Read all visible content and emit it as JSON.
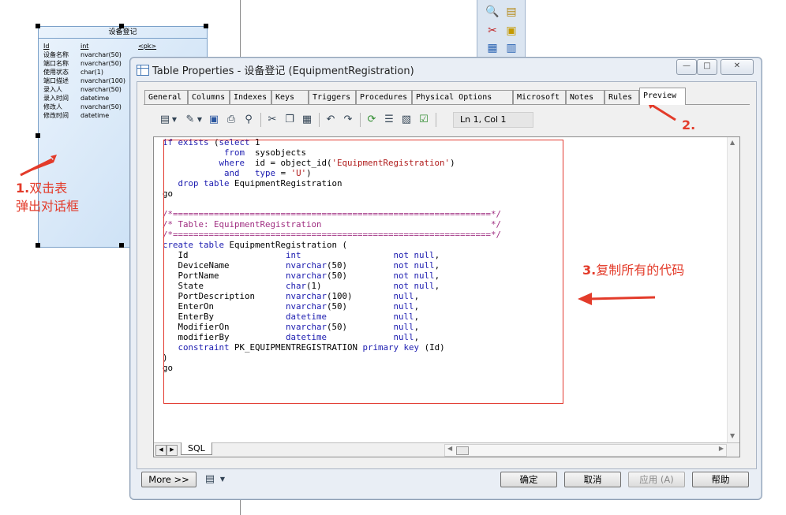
{
  "entity": {
    "title": "设备登记",
    "rows": [
      {
        "name": "Id",
        "type": "int",
        "key": "<pk>"
      },
      {
        "name": "设备名称",
        "type": "nvarchar(50)",
        "key": ""
      },
      {
        "name": "端口名称",
        "type": "nvarchar(50)",
        "key": ""
      },
      {
        "name": "使用状态",
        "type": "char(1)",
        "key": ""
      },
      {
        "name": "端口描述",
        "type": "nvarchar(100)",
        "key": ""
      },
      {
        "name": "录入人",
        "type": "nvarchar(50)",
        "key": ""
      },
      {
        "name": "录入时间",
        "type": "datetime",
        "key": ""
      },
      {
        "name": "修改人",
        "type": "nvarchar(50)",
        "key": ""
      },
      {
        "name": "修改时间",
        "type": "datetime",
        "key": ""
      }
    ]
  },
  "annotations": {
    "step1_num": "1.",
    "step1_line1": "双击表",
    "step1_line2": "弹出对话框",
    "step2": "2.",
    "step3_num": "3.",
    "step3_text": "复制所有的代码",
    "color": "#e33b2a"
  },
  "dialog": {
    "title": "Table Properties - 设备登记 (EquipmentRegistration)",
    "window_buttons": {
      "minimize": "—",
      "maximize": "□",
      "close": "✕"
    },
    "tabs": [
      "General",
      "Columns",
      "Indexes",
      "Keys",
      "Triggers",
      "Procedures",
      "Physical Options",
      "Microsoft",
      "Notes",
      "Rules",
      "Preview"
    ],
    "active_tab": "Preview",
    "cursor_position": "Ln 1, Col 1",
    "toolbar_icons": [
      "script-icon",
      "edit-icon",
      "save-icon",
      "print-icon",
      "find-icon",
      "cut-icon",
      "copy-icon",
      "paste-icon",
      "undo-icon",
      "redo-icon",
      "refresh-icon",
      "list-icon",
      "edit-props-icon",
      "check-icon"
    ],
    "code_lines": [
      "if exists (select 1",
      "            from  sysobjects",
      "           where  id = object_id('EquipmentRegistration')",
      "            and   type = 'U')",
      "   drop table EquipmentRegistration",
      "go",
      "",
      "/*==============================================================*/",
      "/* Table: EquipmentRegistration                                 */",
      "/*==============================================================*/",
      "create table EquipmentRegistration (",
      "   Id                   int                  not null,",
      "   DeviceName           nvarchar(50)         not null,",
      "   PortName             nvarchar(50)         not null,",
      "   State                char(1)              not null,",
      "   PortDescription      nvarchar(100)        null,",
      "   EnterOn              nvarchar(50)         null,",
      "   EnterBy              datetime             null,",
      "   ModifierOn           nvarchar(50)         null,",
      "   modifierBy           datetime             null,",
      "   constraint PK_EQUIPMENTREGISTRATION primary key (Id)",
      ")",
      "go"
    ],
    "sql_tab": "SQL",
    "buttons": {
      "more": "More >>",
      "ok": "确定",
      "cancel": "取消",
      "apply": "应用 (A)",
      "help": "帮助"
    }
  }
}
